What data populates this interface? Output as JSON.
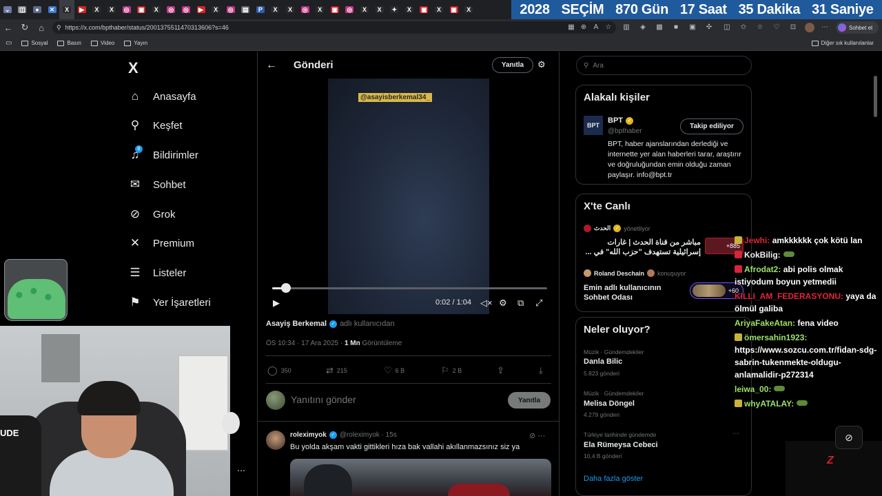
{
  "countdown": {
    "year": "2028",
    "label": "SEÇİM",
    "days": "870 Gün",
    "hours": "17 Saat",
    "minutes": "35 Dakika",
    "seconds": "31 Saniye"
  },
  "tabs": [
    {
      "glyph": "⌄",
      "color": "#6b7aa1"
    },
    {
      "glyph": "◫",
      "color": "#8a8a8a"
    },
    {
      "glyph": "●",
      "color": "#5a6b8f"
    },
    {
      "glyph": "✕",
      "color": "#3a78d6"
    },
    {
      "glyph": "X",
      "color": "#2b2b2b"
    },
    {
      "glyph": "▶",
      "color": "#d62626"
    },
    {
      "glyph": "X",
      "color": "#2b2b2b"
    },
    {
      "glyph": "X",
      "color": "#2b2b2b"
    },
    {
      "glyph": "◎",
      "color": "#c13584"
    },
    {
      "glyph": "▣",
      "color": "#c8202a"
    },
    {
      "glyph": "X",
      "color": "#2b2b2b"
    },
    {
      "glyph": "◎",
      "color": "#c13584"
    },
    {
      "glyph": "◎",
      "color": "#c13584"
    },
    {
      "glyph": "▶",
      "color": "#d62626"
    },
    {
      "glyph": "X",
      "color": "#2b2b2b"
    },
    {
      "glyph": "◎",
      "color": "#c13584"
    },
    {
      "glyph": "▤",
      "color": "#6b6b6b"
    },
    {
      "glyph": "P",
      "color": "#2d5ea8"
    },
    {
      "glyph": "X",
      "color": "#2b2b2b"
    },
    {
      "glyph": "X",
      "color": "#2b2b2b"
    },
    {
      "glyph": "◎",
      "color": "#c13584"
    },
    {
      "glyph": "X",
      "color": "#2b2b2b"
    },
    {
      "glyph": "▣",
      "color": "#c8202a"
    },
    {
      "glyph": "◎",
      "color": "#c13584"
    },
    {
      "glyph": "X",
      "color": "#2b2b2b"
    },
    {
      "glyph": "X",
      "color": "#2b2b2b"
    },
    {
      "glyph": "✦",
      "color": "#2b2b2b"
    },
    {
      "glyph": "X",
      "color": "#2b2b2b"
    },
    {
      "glyph": "▣",
      "color": "#c8202a"
    },
    {
      "glyph": "X",
      "color": "#2b2b2b"
    },
    {
      "glyph": "▣",
      "color": "#c8202a"
    },
    {
      "glyph": "X",
      "color": "#2b2b2b"
    }
  ],
  "browser": {
    "url": "https://x.com/bpthaber/status/2001375511470313606?s=46",
    "profile_label": "Sohbet et"
  },
  "bookmarks": {
    "items": [
      "Sosyal",
      "Basın",
      "Video",
      "Yayın"
    ],
    "other": "Diğer sık kullanılanlar"
  },
  "nav": {
    "logo": "X",
    "items": [
      {
        "label": "Anasayfa",
        "icon": "home-icon"
      },
      {
        "label": "Keşfet",
        "icon": "search-icon"
      },
      {
        "label": "Bildirimler",
        "icon": "bell-icon"
      },
      {
        "label": "Sohbet",
        "icon": "mail-icon"
      },
      {
        "label": "Grok",
        "icon": "grok-icon"
      },
      {
        "label": "Premium",
        "icon": "x-premium-icon"
      },
      {
        "label": "Listeler",
        "icon": "list-icon"
      },
      {
        "label": "Yer İşaretleri",
        "icon": "bookmark-icon"
      }
    ],
    "notification_count": "8"
  },
  "post": {
    "header_title": "Gönderi",
    "header_reply": "Yanıtla",
    "video_watermark": "@asayisberkemal34_",
    "video_time": "0:02 / 1:04",
    "video_progress": 0.05,
    "attribution_name": "Asayiş Berkemal",
    "attribution_suffix": "adlı kullanıcıdan",
    "timestamp": "ÖS 10:34 · 17 Ara 2025 ·",
    "views": "1 Mn",
    "views_label": "Görüntüleme",
    "actions": {
      "replies": "350",
      "reposts": "215",
      "likes": "6 B",
      "bookmarks": "2 B"
    },
    "reply_placeholder": "Yanıtını gönder",
    "reply_button": "Yanıtla"
  },
  "reply_tweet": {
    "name": "roleximyok",
    "handle": "@roleximyok · 15s",
    "text": "Bu yolda akşam vakti gittikleri hıza bak vallahi akıllanmazsınız siz ya"
  },
  "right": {
    "search_placeholder": "Ara",
    "people_title": "Alakalı kişiler",
    "bpt_avatar": "BPT",
    "bpt_name": "BPT",
    "bpt_handle": "@bpthaber",
    "bpt_follow": "Takip ediliyor",
    "bpt_bio": "BPT, haber ajanslarından derlediği ve internette yer alan haberleri tarar, araştırır ve doğruluğundan emin olduğu zaman paylaşır. info@bpt.tr",
    "live_title": "X'te Canlı",
    "live1_host": "الحدث",
    "live1_role": "yönetliyor",
    "live1_text": "مباشر من قناة الحدث | غارات إسرائيلية تستهدف \"حزب الله\" في ...",
    "live1_count": "+885",
    "live2_host": "Roland Deschain",
    "live2_role": "konuşuyor",
    "live2_text": "Emin adlı kullanıcının Sohbet Odası",
    "live2_count": "+60",
    "trends_title": "Neler oluyor?",
    "trends": [
      {
        "category": "Müzik · Gündemdekiler",
        "name": "Danla Bilic",
        "count": "5.823 gönderi"
      },
      {
        "category": "Müzik · Gündemdekiler",
        "name": "Melisa Döngel",
        "count": "4.279 gönderi"
      },
      {
        "category": "Türkiye tarihinde gündemde",
        "name": "Ela Rümeysa Cebeci",
        "count": "10,4 B gönderi"
      }
    ],
    "show_more": "Daha fazla göster"
  },
  "chat": [
    {
      "user": "Jewhi:",
      "msg": "amkkkkkk çok kötü lan",
      "color": "#e0253a",
      "badge": "#c9b23a"
    },
    {
      "user": "KokBilig:",
      "msg": "",
      "color": "#f2f2f2",
      "badge": "#d6263a",
      "emote": true
    },
    {
      "user": "Afrodat2:",
      "msg": "abi polis olmak istiyodum boyun yetmedii",
      "color": "#9ee26a",
      "badge": "#d6263a"
    },
    {
      "user": "KILLI_AM_FEDERASYONU:",
      "msg": "yaya da ölmül galiba",
      "color": "#e0253a",
      "badge": ""
    },
    {
      "user": "AriyaFakeAtan:",
      "msg": "fena video",
      "color": "#9ee26a",
      "badge": ""
    },
    {
      "user": "ömersahin1923:",
      "msg": "https://www.sozcu.com.tr/fidan-sdg-sabrin-tukenmekte-oldugu-anlamalidir-p272314",
      "color": "#9ee26a",
      "badge": "#c9b23a"
    },
    {
      "user": "leiwa_00:",
      "msg": "",
      "color": "#9ee26a",
      "badge": "",
      "emote": true
    },
    {
      "user": "whyATALAY:",
      "msg": "",
      "color": "#9ee26a",
      "badge": "#c9b23a",
      "emote": true
    }
  ],
  "webcam": {
    "shirt_text": "UDE"
  }
}
